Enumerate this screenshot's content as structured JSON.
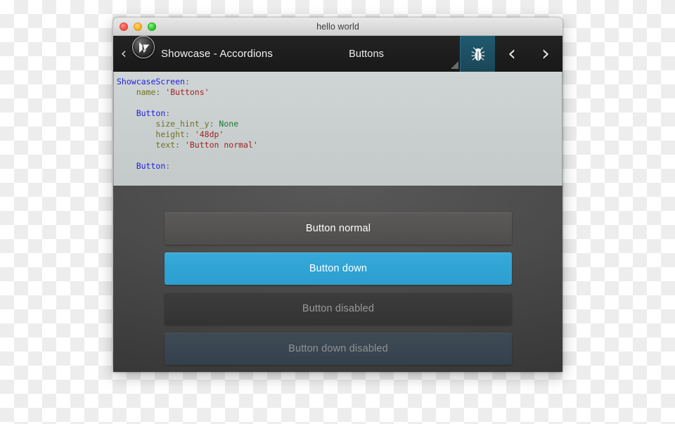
{
  "window": {
    "title": "hello world",
    "traffic_lights": [
      "close-button",
      "minimize-button",
      "maximize-button"
    ]
  },
  "actionbar": {
    "back_chevron": "‹",
    "logo_icon": "kivy-logo-icon",
    "app_title": "Showcase - Accordions",
    "spinner_value": "Buttons",
    "spinner_triangle": "dropdown-triangle-icon",
    "bug_icon": "bug-icon",
    "prev_chevron": "‹",
    "next_chevron": "›"
  },
  "editor": {
    "language": "kv",
    "lines": [
      [
        {
          "t": "ShowcaseScreen",
          "c": "t-cls"
        },
        {
          "t": ":",
          "c": "t-pun"
        }
      ],
      [
        {
          "t": "    ",
          "c": "t-plain"
        },
        {
          "t": "name",
          "c": "t-key"
        },
        {
          "t": ": ",
          "c": "t-pun"
        },
        {
          "t": "'Buttons'",
          "c": "t-str"
        }
      ],
      [],
      [
        {
          "t": "    ",
          "c": "t-plain"
        },
        {
          "t": "Button",
          "c": "t-cls"
        },
        {
          "t": ":",
          "c": "t-pun"
        }
      ],
      [
        {
          "t": "        ",
          "c": "t-plain"
        },
        {
          "t": "size_hint_y",
          "c": "t-key"
        },
        {
          "t": ": ",
          "c": "t-pun"
        },
        {
          "t": "None",
          "c": "t-none"
        }
      ],
      [
        {
          "t": "        ",
          "c": "t-plain"
        },
        {
          "t": "height",
          "c": "t-key"
        },
        {
          "t": ": ",
          "c": "t-pun"
        },
        {
          "t": "'48dp'",
          "c": "t-str"
        }
      ],
      [
        {
          "t": "        ",
          "c": "t-plain"
        },
        {
          "t": "text",
          "c": "t-key"
        },
        {
          "t": ": ",
          "c": "t-pun"
        },
        {
          "t": "'Button normal'",
          "c": "t-str"
        }
      ],
      [],
      [
        {
          "t": "    ",
          "c": "t-plain"
        },
        {
          "t": "Button",
          "c": "t-cls"
        },
        {
          "t": ":",
          "c": "t-pun"
        }
      ]
    ]
  },
  "panel": {
    "buttons": [
      {
        "label": "Button normal",
        "state": "normal",
        "name": "button-normal"
      },
      {
        "label": "Button down",
        "state": "down",
        "name": "button-down"
      },
      {
        "label": "Button disabled",
        "state": "disabled",
        "name": "button-disabled"
      },
      {
        "label": "Button down disabled",
        "state": "down-disabled",
        "name": "button-down-disabled"
      }
    ]
  },
  "colors": {
    "accent_blue": "#2fa3d4",
    "bug_tab_teal": "#1d4f62",
    "actionbar_dark": "#1e1e1e",
    "panel_gray": "#4b4b4b",
    "editor_bg": "#c9cfcf",
    "disabled_text": "#999999",
    "down_disabled_bg": "#394550"
  }
}
